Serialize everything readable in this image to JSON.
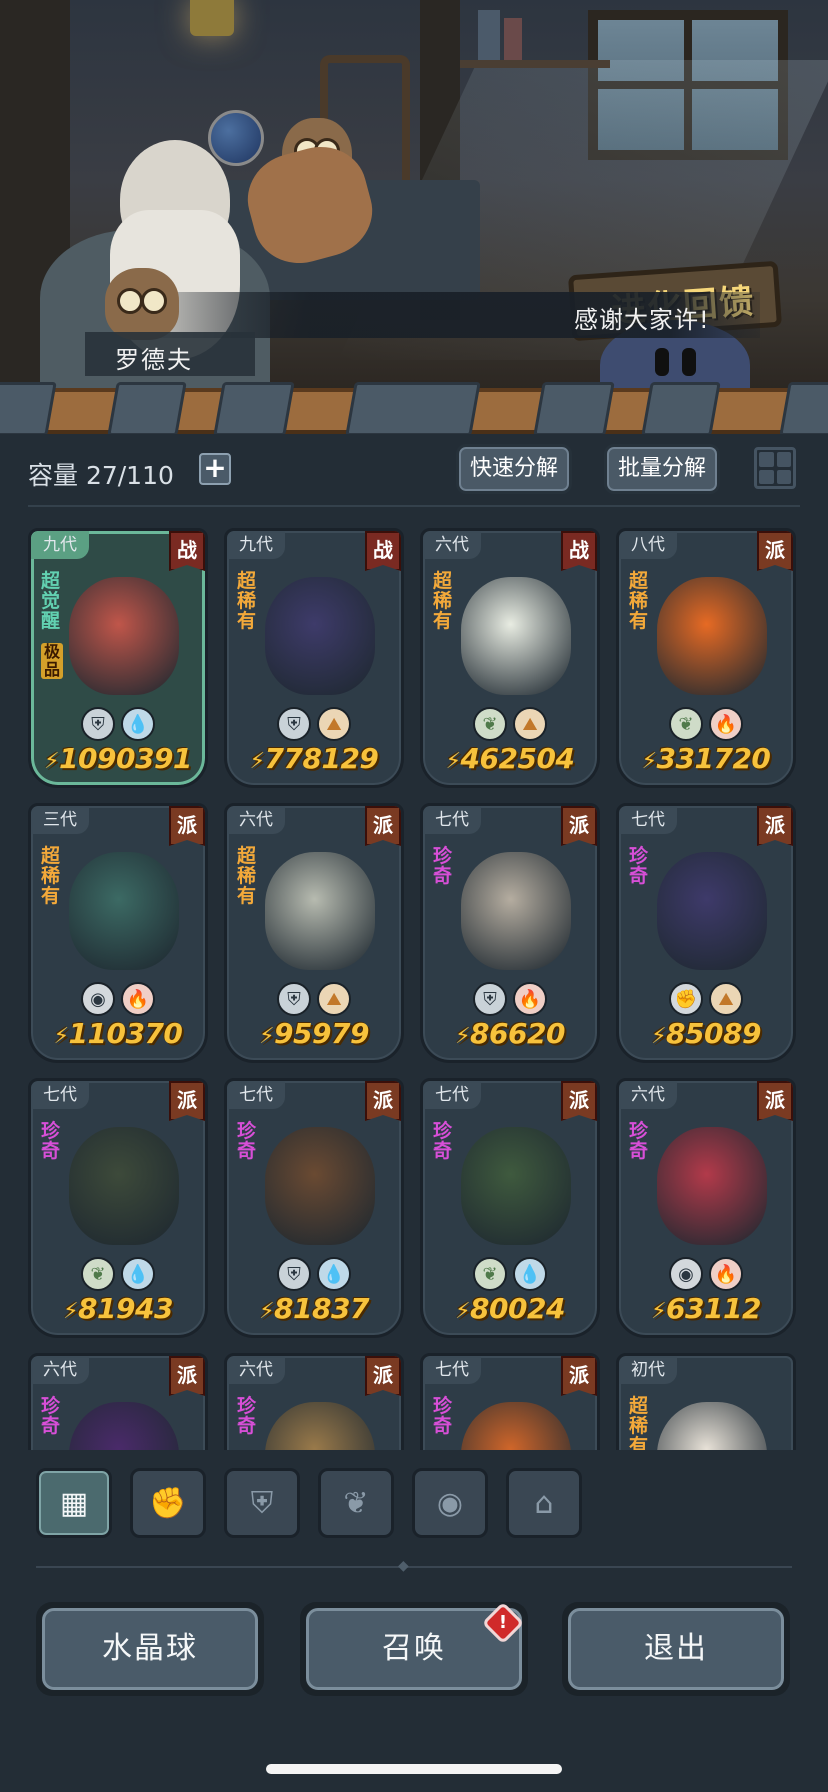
{
  "scene": {
    "dialogue_text": "感谢大家许!",
    "speaker_name": "罗德夫",
    "sign_text": "进化回馈"
  },
  "toolbar": {
    "capacity_label": "容量 27/110",
    "plus_label": "+",
    "quick_decompose": "快速分解",
    "batch_decompose": "批量分解"
  },
  "cards": [
    {
      "gen": "九代",
      "type": "战",
      "rarity": "超觉醒",
      "sub": "极品",
      "elements": [
        "shield",
        "water"
      ],
      "power": "1090391",
      "highlight": true,
      "color": "#c0564a"
    },
    {
      "gen": "九代",
      "type": "战",
      "rarity": "超稀有",
      "elements": [
        "shield",
        "earth"
      ],
      "power": "778129",
      "color": "#3e3b6a"
    },
    {
      "gen": "六代",
      "type": "战",
      "rarity": "超稀有",
      "elements": [
        "leaf",
        "earth"
      ],
      "power": "462504",
      "color": "#e8ece2"
    },
    {
      "gen": "八代",
      "type": "派",
      "rarity": "超稀有",
      "elements": [
        "leaf",
        "fire"
      ],
      "power": "331720",
      "color": "#e66a24"
    },
    {
      "gen": "三代",
      "type": "派",
      "rarity": "超稀有",
      "elements": [
        "alien",
        "fire"
      ],
      "power": "110370",
      "color": "#3c6a64"
    },
    {
      "gen": "六代",
      "type": "派",
      "rarity": "超稀有",
      "elements": [
        "shield",
        "earth"
      ],
      "power": "95979",
      "color": "#b7bbb0"
    },
    {
      "gen": "七代",
      "type": "派",
      "rarity": "珍奇",
      "elements": [
        "shield",
        "fire"
      ],
      "power": "86620",
      "color": "#b5ada0"
    },
    {
      "gen": "七代",
      "type": "派",
      "rarity": "珍奇",
      "elements": [
        "fist",
        "earth"
      ],
      "power": "85089",
      "color": "#3e3a6a"
    },
    {
      "gen": "七代",
      "type": "派",
      "rarity": "珍奇",
      "elements": [
        "leaf",
        "water"
      ],
      "power": "81943",
      "color": "#3d4a3a"
    },
    {
      "gen": "七代",
      "type": "派",
      "rarity": "珍奇",
      "elements": [
        "shield",
        "water"
      ],
      "power": "81837",
      "color": "#6a4a32"
    },
    {
      "gen": "七代",
      "type": "派",
      "rarity": "珍奇",
      "elements": [
        "leaf",
        "water"
      ],
      "power": "80024",
      "color": "#3f5a3e"
    },
    {
      "gen": "六代",
      "type": "派",
      "rarity": "珍奇",
      "elements": [
        "alien",
        "fire"
      ],
      "power": "63112",
      "color": "#b23a4a"
    },
    {
      "gen": "六代",
      "type": "派",
      "rarity": "珍奇",
      "elements": [],
      "power": "",
      "color": "#4a2a6a"
    },
    {
      "gen": "六代",
      "type": "派",
      "rarity": "珍奇",
      "elements": [],
      "power": "",
      "color": "#9a7a4a"
    },
    {
      "gen": "七代",
      "type": "派",
      "rarity": "珍奇",
      "elements": [],
      "power": "",
      "color": "#d0662a"
    },
    {
      "gen": "初代",
      "type": "",
      "rarity": "超稀有",
      "elements": [],
      "power": "",
      "color": "#e8e2d8"
    }
  ],
  "filters": [
    {
      "name": "all",
      "icon": "▦",
      "active": true
    },
    {
      "name": "fist",
      "icon": "✊"
    },
    {
      "name": "shield",
      "icon": "⛨"
    },
    {
      "name": "leaf",
      "icon": "❦"
    },
    {
      "name": "alien",
      "icon": "◉"
    },
    {
      "name": "fortress",
      "icon": "⌂"
    }
  ],
  "bottom": {
    "crystal_ball": "水晶球",
    "summon": "召唤",
    "summon_alert": "!",
    "exit": "退出"
  },
  "colors": {
    "power_gold": "#f7c23c",
    "super_rare": "#f3a93a",
    "rare": "#d74fd7",
    "awakened": "#62d1b1",
    "battle_badge": "#7a2a22"
  }
}
